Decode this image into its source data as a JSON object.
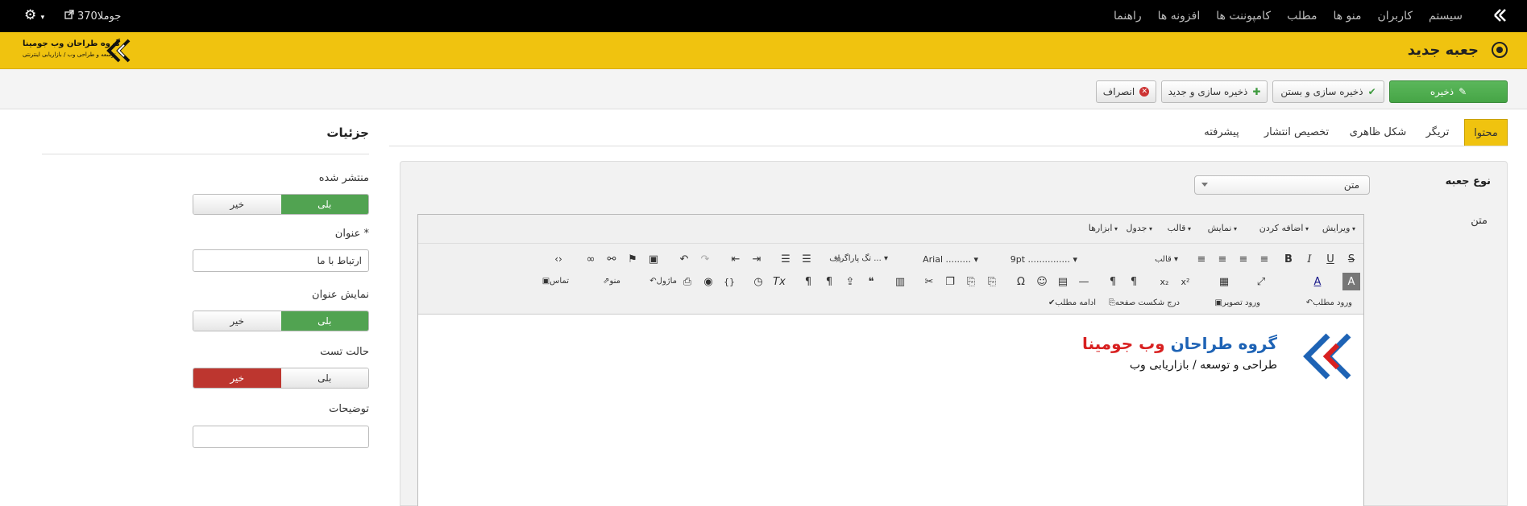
{
  "topbar": {
    "menu": [
      "سیستم",
      "کاربران",
      "منو ها",
      "مطلب",
      "کامپوننت ها",
      "افزونه ها",
      "راهنما"
    ],
    "site_name": "جوملا370"
  },
  "header": {
    "title": "جعبه جدید",
    "brand_line1": "گروه طراحان وب جومینا",
    "brand_line2": "توسعه و طراحی وب / بازاریابی اینترنتی"
  },
  "toolbar": {
    "save": "ذخیره",
    "save_close": "ذخیره سازی و بستن",
    "save_new": "ذخیره سازی و جدید",
    "cancel": "انصراف"
  },
  "tabs": [
    "محتوا",
    "تریگر",
    "شکل ظاهری",
    "تخصیص انتشار",
    "پیشرفته"
  ],
  "content": {
    "type_label": "نوع جعبه",
    "type_value": "متن",
    "text_label": "متن"
  },
  "editor": {
    "menubar": [
      "ویرایش",
      "اضافه کردن",
      "نمایش",
      "قالب",
      "جدول",
      "ابزارها"
    ],
    "font_size": "9pt",
    "font_family": "Arial",
    "format": "تگ پاراگراف ...",
    "style_label": "قالب",
    "contact": "تماس",
    "menu_btn": "منو",
    "module_btn": "ماژول",
    "insert_article": "ورود مطلب",
    "insert_image": "ورود تصویر",
    "page_break": "درج شکست صفحه",
    "read_more": "ادامه مطلب",
    "logo_line1_blue": "گروه طراحان",
    "logo_line1_red": "وب جومینا",
    "logo_line2": "طراحی و توسعه / بازاریابی وب"
  },
  "details": {
    "heading": "جزئیات",
    "published_label": "منتشر شده",
    "yes": "بلی",
    "no": "خیر",
    "title_label": "عنوان *",
    "title_value": "ارتباط با ما",
    "show_title_label": "نمایش عنوان",
    "test_mode_label": "حالت تست",
    "description_label": "توضیحات",
    "description_value": ""
  },
  "colors": {
    "header_bg": "#f0c30f",
    "save_green": "#46a546",
    "toggle_green": "#51a351",
    "toggle_red": "#bd362f"
  }
}
